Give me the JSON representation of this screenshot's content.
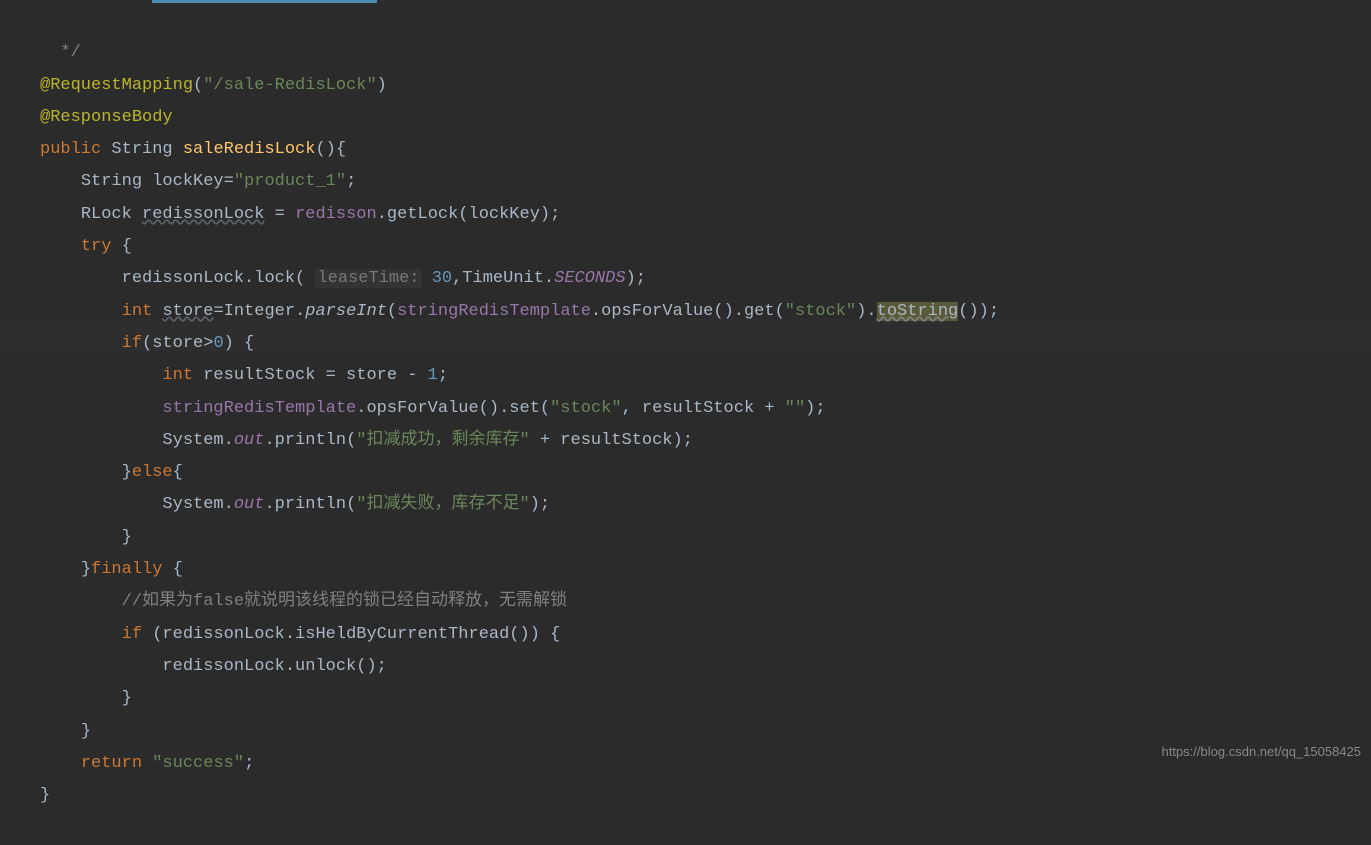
{
  "code": {
    "l0_comment": "*/",
    "l1_anno": "@RequestMapping",
    "l1_paren_open": "(",
    "l1_str": "\"/sale-RedisLock\"",
    "l1_paren_close": ")",
    "l2_anno": "@ResponseBody",
    "l3_kw1": "public ",
    "l3_type": "String ",
    "l3_method": "saleRedisLock",
    "l3_rest": "(){",
    "l4_type": "String lockKey=",
    "l4_str": "\"product_1\"",
    "l4_semi": ";",
    "l5_type": "RLock ",
    "l5_var": "redissonLock",
    "l5_eq": " = ",
    "l5_field": "redisson",
    "l5_call": ".getLock(lockKey);",
    "l6_kw": "try ",
    "l6_brace": "{",
    "l7_call1": "redissonLock.lock( ",
    "l7_hint": "leaseTime:",
    "l7_num": " 30",
    "l7_comma": ",TimeUnit.",
    "l7_const": "SECONDS",
    "l7_end": ");",
    "l8_kw": "int ",
    "l8_var": "store",
    "l8_eq": "=Integer.",
    "l8_method": "parseInt",
    "l8_p1": "(",
    "l8_field": "stringRedisTemplate",
    "l8_call": ".opsForValue().get(",
    "l8_str": "\"stock\"",
    "l8_p2": ").",
    "l8_tostring": "toString",
    "l8_end": "());",
    "l9_kw": "if",
    "l9_cond": "(store>",
    "l9_num": "0",
    "l9_rest": ") {",
    "l10_kw": "int ",
    "l10_rest": "resultStock = store - ",
    "l10_num": "1",
    "l10_semi": ";",
    "l11_field": "stringRedisTemplate",
    "l11_call": ".opsForValue().set(",
    "l11_str": "\"stock\"",
    "l11_rest": ", resultStock + ",
    "l11_str2": "\"\"",
    "l11_end": ");",
    "l12_sys": "System.",
    "l12_out": "out",
    "l12_call": ".println(",
    "l12_str": "\"扣减成功，剩余库存\"",
    "l12_rest": " + resultStock);",
    "l13_brace": "}",
    "l13_kw": "else",
    "l13_brace2": "{",
    "l14_sys": "System.",
    "l14_out": "out",
    "l14_call": ".println(",
    "l14_str": "\"扣减失败，库存不足\"",
    "l14_end": ");",
    "l15_brace": "}",
    "l16_brace": "}",
    "l16_kw": "finally ",
    "l16_brace2": "{",
    "l17_comment": "//如果为false就说明该线程的锁已经自动释放，无需解锁",
    "l18_kw": "if ",
    "l18_rest": "(redissonLock.isHeldByCurrentThread()) {",
    "l19_call": "redissonLock.unlock();",
    "l20_brace": "}",
    "l21_brace": "}",
    "l22_kw": "return ",
    "l22_str": "\"success\"",
    "l22_semi": ";",
    "l23_brace": "}"
  },
  "watermark": "https://blog.csdn.net/qq_15058425"
}
